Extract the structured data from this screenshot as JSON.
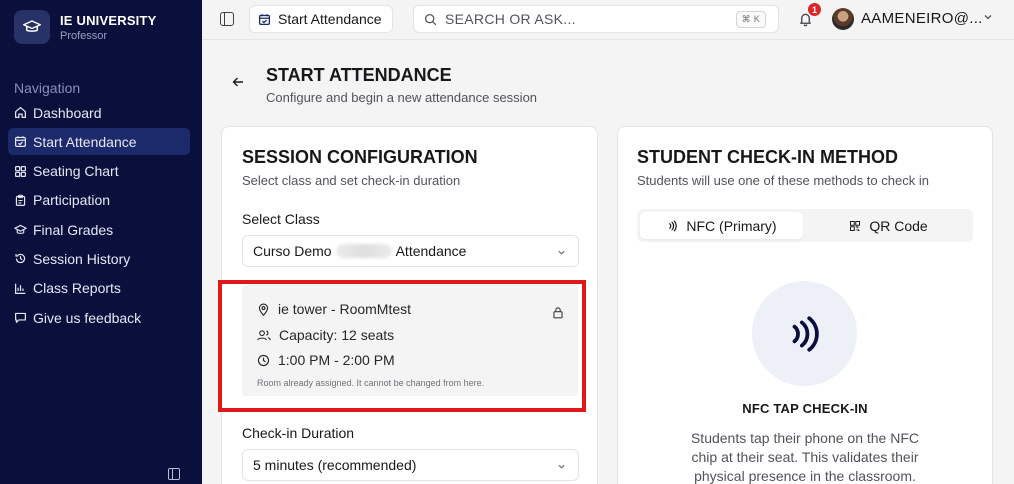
{
  "brand": {
    "title": "IE UNIVERSITY",
    "subtitle": "Professor"
  },
  "sidebar": {
    "heading": "Navigation",
    "items": [
      {
        "label": "Dashboard",
        "icon": "home-icon",
        "active": false
      },
      {
        "label": "Start Attendance",
        "icon": "calendar-check-icon",
        "active": true
      },
      {
        "label": "Seating Chart",
        "icon": "grid-icon",
        "active": false
      },
      {
        "label": "Participation",
        "icon": "clipboard-icon",
        "active": false
      },
      {
        "label": "Final Grades",
        "icon": "graduation-cap-icon",
        "active": false
      },
      {
        "label": "Session History",
        "icon": "history-icon",
        "active": false
      },
      {
        "label": "Class Reports",
        "icon": "bar-chart-icon",
        "active": false
      },
      {
        "label": "Give us feedback",
        "icon": "message-icon",
        "active": false
      }
    ]
  },
  "topbar": {
    "crumb": "Start Attendance",
    "search_placeholder": "SEARCH OR ASK...",
    "shortcut": "⌘ K",
    "notification_count": "1",
    "user": "AAMENEIRO@..."
  },
  "page": {
    "title": "START ATTENDANCE",
    "subtitle": "Configure and begin a new attendance session"
  },
  "session": {
    "title": "SESSION CONFIGURATION",
    "subtitle": "Select class and set check-in duration",
    "class_label": "Select Class",
    "class_value_start": "Curso Demo",
    "class_value_end": "Attendance",
    "room": "ie tower - RoomMtest",
    "capacity": "Capacity: 12 seats",
    "time": "1:00 PM - 2:00 PM",
    "room_note": "Room already assigned. It cannot be changed from here.",
    "duration_label": "Check-in Duration",
    "duration_value": "5 minutes (recommended)"
  },
  "checkin": {
    "title": "STUDENT CHECK-IN METHOD",
    "subtitle": "Students will use one of these methods to check in",
    "tab_nfc": "NFC (Primary)",
    "tab_qr": "QR Code",
    "method_title": "NFC TAP CHECK-IN",
    "method_desc": "Students tap their phone on the NFC chip at their seat. This validates their physical presence in the classroom."
  },
  "colors": {
    "sidebar_bg": "#0a0f3c",
    "active_item": "#1c2a6b",
    "highlight": "#e01818",
    "nfc_icon": "#0a0f3c"
  }
}
